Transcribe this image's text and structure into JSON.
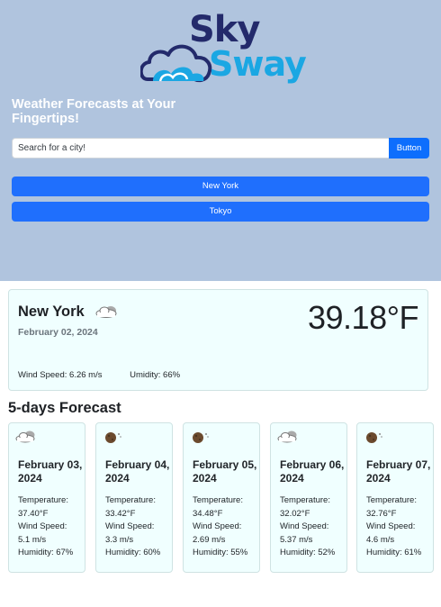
{
  "brand": {
    "word1": "Sky",
    "word2": "Sway",
    "colors": {
      "dark": "#232a6b",
      "light": "#1ba7e3"
    }
  },
  "hero": {
    "tagline": "Weather Forecasts at Your Fingertips!",
    "background": "#b0c4de"
  },
  "search": {
    "placeholder": "Search for a city!",
    "value": "",
    "button_label": "Button"
  },
  "history": [
    "New York",
    "Tokyo"
  ],
  "current": {
    "city": "New York",
    "icon": "cloudy-icon",
    "date": "February 02, 2024",
    "temperature": "39.18°F",
    "wind": "Wind Speed: 6.26 m/s",
    "humidity": "Umidity: 66%"
  },
  "forecast_title": "5-days Forecast",
  "forecast": [
    {
      "icon": "cloudy-icon",
      "date": "February 03, 2024",
      "temp_label": "Temperature:",
      "temp": "37.40°F",
      "wind_label": "Wind Speed:",
      "wind": "5.1 m/s",
      "humidity": "Humidity: 67%"
    },
    {
      "icon": "moon-icon",
      "date": "February 04, 2024",
      "temp_label": "Temperature:",
      "temp": "33.42°F",
      "wind_label": "Wind Speed:",
      "wind": "3.3 m/s",
      "humidity": "Humidity: 60%"
    },
    {
      "icon": "moon-icon",
      "date": "February 05, 2024",
      "temp_label": "Temperature:",
      "temp": "34.48°F",
      "wind_label": "Wind Speed:",
      "wind": "2.69 m/s",
      "humidity": "Humidity: 55%"
    },
    {
      "icon": "cloudy-icon",
      "date": "February 06, 2024",
      "temp_label": "Temperature:",
      "temp": "32.02°F",
      "wind_label": "Wind Speed:",
      "wind": "5.37 m/s",
      "humidity": "Humidity: 52%"
    },
    {
      "icon": "moon-icon",
      "date": "February 07, 2024",
      "temp_label": "Temperature:",
      "temp": "32.76°F",
      "wind_label": "Wind Speed:",
      "wind": "4.6 m/s",
      "humidity": "Humidity: 61%"
    }
  ]
}
